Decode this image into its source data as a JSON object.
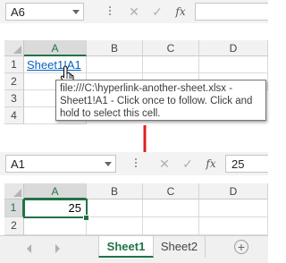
{
  "top": {
    "namebox": "A6",
    "fx": "fx",
    "columns": [
      "A",
      "B",
      "C",
      "D"
    ],
    "rows": [
      "1",
      "2",
      "3",
      "4"
    ],
    "link_text": "Sheet1!A1",
    "tooltip": [
      "file:///C:\\hyperlink-another-sheet.xlsx -",
      "Sheet1!A1 - Click once to follow. Click and",
      "hold to select this cell."
    ]
  },
  "bottom": {
    "namebox": "A1",
    "fx": "fx",
    "formula_value": "25",
    "columns": [
      "A",
      "B",
      "C",
      "D"
    ],
    "rows": [
      "1",
      "2"
    ],
    "cell_a1": "25"
  },
  "tabs": {
    "sheet1": "Sheet1",
    "sheet2": "Sheet2",
    "add": "+"
  },
  "colors": {
    "excel_green": "#217346",
    "link_blue": "#0563c1",
    "arrow_red": "#e02020"
  }
}
